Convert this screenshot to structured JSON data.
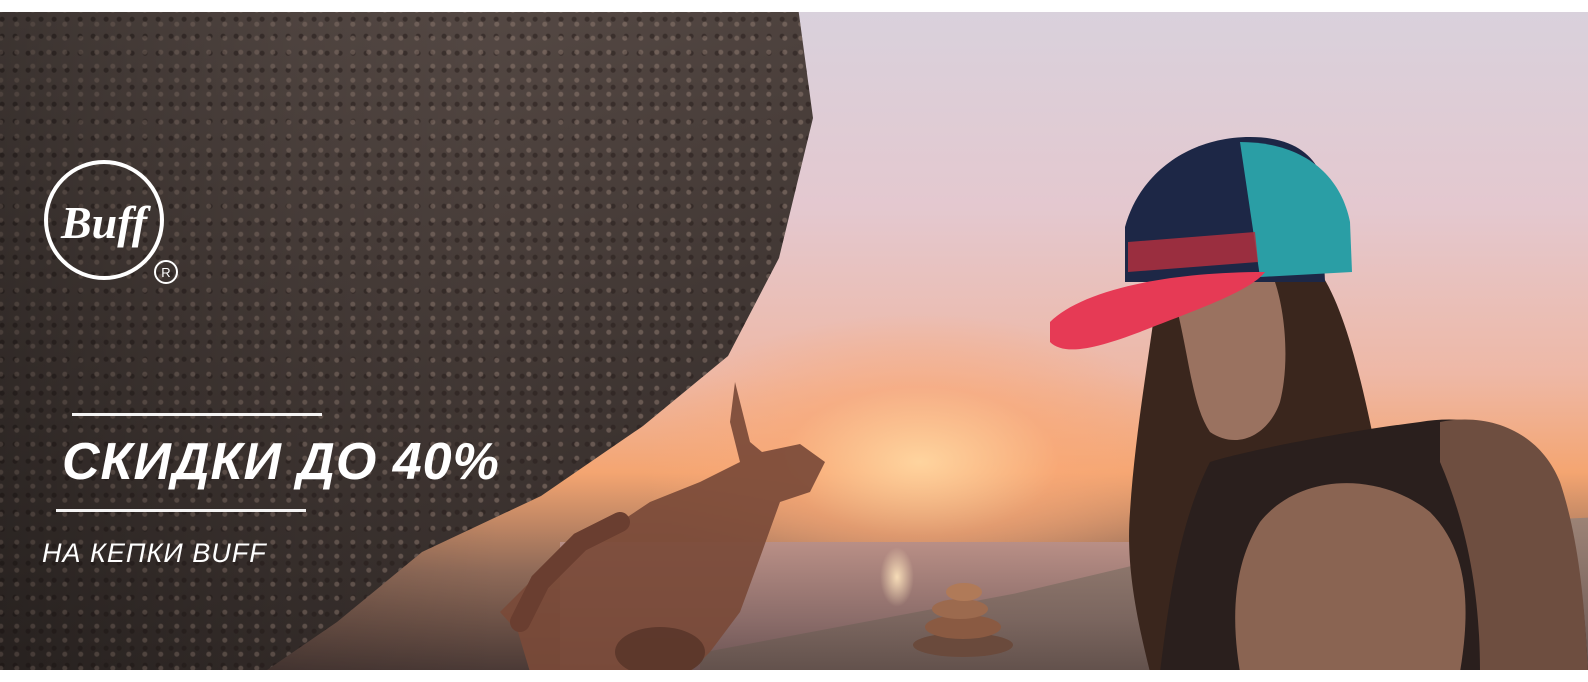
{
  "banner": {
    "logo": {
      "brand": "Buff",
      "registered_mark": "R"
    },
    "headline": "СКИДКИ ДО 40%",
    "subline": "НА КЕПКИ BUFF",
    "colors": {
      "text": "#ffffff",
      "cap_visor": "#e63a55",
      "cap_mesh": "#2a9ea5",
      "cap_front": "#1d2746"
    }
  }
}
